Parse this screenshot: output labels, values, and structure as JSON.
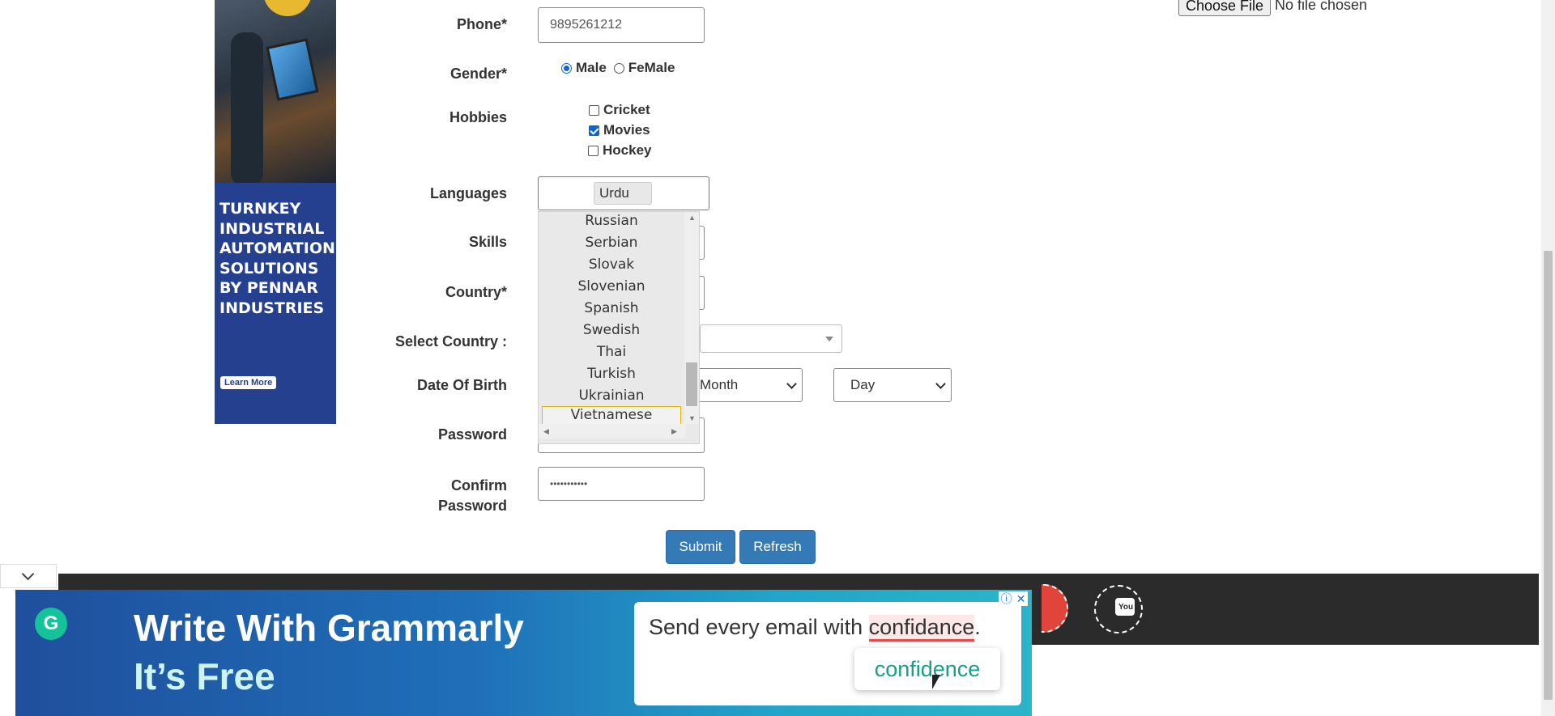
{
  "side_ad": {
    "headline": "TURNKEY INDUSTRIAL AUTOMATION SOLUTIONS BY PENNAR INDUSTRIES",
    "cta": "Learn More"
  },
  "form": {
    "phone": {
      "label": "Phone*",
      "value": "9895261212"
    },
    "gender": {
      "label": "Gender*",
      "options": [
        "Male",
        "FeMale"
      ],
      "selected": "Male"
    },
    "hobbies": {
      "label": "Hobbies",
      "items": [
        {
          "label": "Cricket",
          "checked": false
        },
        {
          "label": "Movies",
          "checked": true
        },
        {
          "label": "Hockey",
          "checked": false
        }
      ]
    },
    "languages": {
      "label": "Languages",
      "selected_tag": "Urdu",
      "options": [
        "Russian",
        "Serbian",
        "Slovak",
        "Slovenian",
        "Spanish",
        "Swedish",
        "Thai",
        "Turkish",
        "Ukrainian",
        "Vietnamese"
      ],
      "highlighted": "Vietnamese"
    },
    "skills": {
      "label": "Skills"
    },
    "country": {
      "label": "Country*"
    },
    "select_country": {
      "label": "Select Country :"
    },
    "dob": {
      "label": "Date Of Birth",
      "month": "Month",
      "day": "Day"
    },
    "password": {
      "label": "Password"
    },
    "confirm_password": {
      "label": "Confirm Password",
      "value": "•••••••••••"
    },
    "submit": "Submit",
    "refresh": "Refresh"
  },
  "file_upload": {
    "button": "Choose File",
    "status": "No file chosen"
  },
  "bottom_ad": {
    "headline1": "Write With Grammarly",
    "headline2": "It’s Free",
    "logo_letter": "G",
    "message_prefix": "Send every email with ",
    "misspelled": "confidance",
    "message_suffix": ".",
    "suggestion": "confidence",
    "adchoice_info": "ⓘ",
    "adchoice_close": "✕"
  },
  "footer": {
    "youtube_icon_text": "You"
  },
  "colors": {
    "primary_button": "#337ab7",
    "footer_bg": "#2b2b2b",
    "ad_blue": "#24408f",
    "checkbox_blue": "#0a66d8"
  }
}
